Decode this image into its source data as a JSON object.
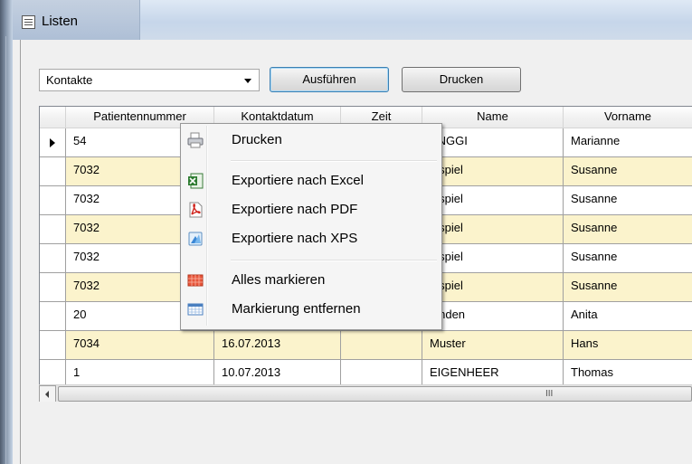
{
  "window": {
    "title": "Listen"
  },
  "toolbar": {
    "list_select_value": "Kontakte",
    "execute_label": "Ausführen",
    "print_label": "Drucken"
  },
  "grid": {
    "columns": [
      "Patientennummer",
      "Kontaktdatum",
      "Zeit",
      "Name",
      "Vorname"
    ],
    "rows": [
      {
        "patientennummer": "54",
        "kontaktdatum": "",
        "zeit": "",
        "name": "ÄNGGI",
        "vorname": "Marianne"
      },
      {
        "patientennummer": "7032",
        "kontaktdatum": "",
        "zeit": "",
        "name": "eispiel",
        "vorname": "Susanne"
      },
      {
        "patientennummer": "7032",
        "kontaktdatum": "",
        "zeit": "",
        "name": "eispiel",
        "vorname": "Susanne"
      },
      {
        "patientennummer": "7032",
        "kontaktdatum": "",
        "zeit": "",
        "name": "eispiel",
        "vorname": "Susanne"
      },
      {
        "patientennummer": "7032",
        "kontaktdatum": "",
        "zeit": "",
        "name": "eispiel",
        "vorname": "Susanne"
      },
      {
        "patientennummer": "7032",
        "kontaktdatum": "",
        "zeit": "",
        "name": "eispiel",
        "vorname": "Susanne"
      },
      {
        "patientennummer": "20",
        "kontaktdatum": "",
        "zeit": "",
        "name": "binden",
        "vorname": "Anita"
      },
      {
        "patientennummer": "7034",
        "kontaktdatum": "16.07.2013",
        "zeit": "",
        "name": "Muster",
        "vorname": "Hans"
      },
      {
        "patientennummer": "1",
        "kontaktdatum": "10.07.2013",
        "zeit": "",
        "name": "EIGENHEER",
        "vorname": "Thomas"
      }
    ],
    "row_colors": {
      "highlight": "#fbf3cc",
      "normal": "#ffffff"
    },
    "hscroll_grip": "III"
  },
  "context_menu": {
    "items": [
      {
        "label": "Drucken",
        "icon": "printer-icon"
      },
      {
        "label": "Exportiere nach Excel",
        "icon": "excel-icon"
      },
      {
        "label": "Exportiere nach PDF",
        "icon": "pdf-icon"
      },
      {
        "label": "Exportiere nach XPS",
        "icon": "xps-icon"
      },
      {
        "label": "Alles markieren",
        "icon": "select-all-icon"
      },
      {
        "label": "Markierung entfernen",
        "icon": "clear-selection-icon"
      }
    ]
  }
}
